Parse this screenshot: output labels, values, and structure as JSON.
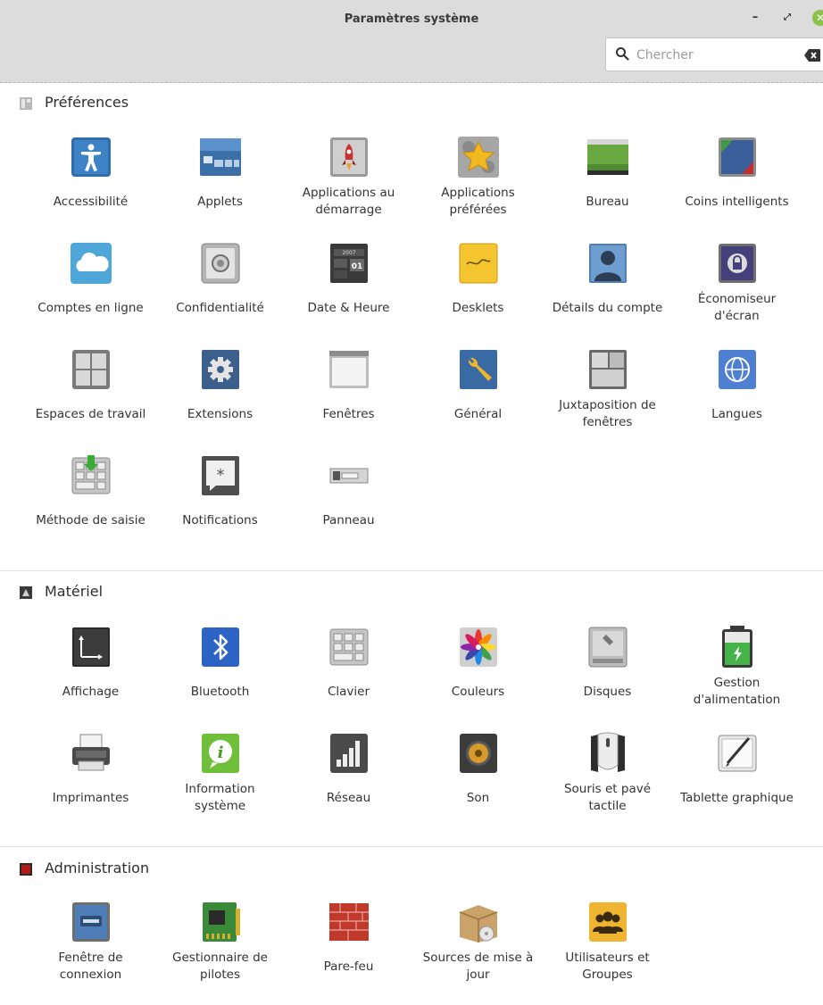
{
  "window": {
    "title": "Paramètres système",
    "min_glyph": "–",
    "max_glyph": "⤢",
    "close_glyph": "✕"
  },
  "search": {
    "placeholder": "Chercher",
    "value": ""
  },
  "sections": {
    "preferences": {
      "title": "Préférences",
      "items": [
        {
          "label": "Accessibilité",
          "icon": "accessibility-icon"
        },
        {
          "label": "Applets",
          "icon": "applets-icon"
        },
        {
          "label": "Applications au démarrage",
          "icon": "startup-applications-icon"
        },
        {
          "label": "Applications préférées",
          "icon": "preferred-applications-icon"
        },
        {
          "label": "Bureau",
          "icon": "desktop-icon"
        },
        {
          "label": "Coins intelligents",
          "icon": "hot-corners-icon"
        },
        {
          "label": "Comptes en ligne",
          "icon": "online-accounts-icon"
        },
        {
          "label": "Confidentialité",
          "icon": "privacy-icon"
        },
        {
          "label": "Date & Heure",
          "icon": "calendar-clock-icon"
        },
        {
          "label": "Desklets",
          "icon": "desklets-icon"
        },
        {
          "label": "Détails du compte",
          "icon": "account-details-icon"
        },
        {
          "label": "Économiseur d'écran",
          "icon": "screensaver-lock-icon"
        },
        {
          "label": "Espaces de travail",
          "icon": "workspaces-icon"
        },
        {
          "label": "Extensions",
          "icon": "extensions-gear-icon"
        },
        {
          "label": "Fenêtres",
          "icon": "windows-icon"
        },
        {
          "label": "Général",
          "icon": "general-wrench-icon"
        },
        {
          "label": "Juxtaposition de fenêtres",
          "icon": "window-tiling-icon"
        },
        {
          "label": "Langues",
          "icon": "languages-globe-icon"
        },
        {
          "label": "Méthode de saisie",
          "icon": "input-method-icon"
        },
        {
          "label": "Notifications",
          "icon": "notifications-icon"
        },
        {
          "label": "Panneau",
          "icon": "panel-icon"
        }
      ]
    },
    "hardware": {
      "title": "Matériel",
      "items": [
        {
          "label": "Affichage",
          "icon": "display-icon"
        },
        {
          "label": "Bluetooth",
          "icon": "bluetooth-icon"
        },
        {
          "label": "Clavier",
          "icon": "keyboard-icon"
        },
        {
          "label": "Couleurs",
          "icon": "colors-icon"
        },
        {
          "label": "Disques",
          "icon": "disks-icon"
        },
        {
          "label": "Gestion d'alimentation",
          "icon": "battery-icon"
        },
        {
          "label": "Imprimantes",
          "icon": "printer-icon"
        },
        {
          "label": "Information système",
          "icon": "system-info-icon"
        },
        {
          "label": "Réseau",
          "icon": "network-signal-icon"
        },
        {
          "label": "Son",
          "icon": "speaker-icon"
        },
        {
          "label": "Souris et pavé tactile",
          "icon": "mouse-icon"
        },
        {
          "label": "Tablette graphique",
          "icon": "graphics-tablet-icon"
        }
      ]
    },
    "administration": {
      "title": "Administration",
      "items": [
        {
          "label": "Fenêtre de connexion",
          "icon": "login-window-icon"
        },
        {
          "label": "Gestionnaire de pilotes",
          "icon": "driver-manager-icon"
        },
        {
          "label": "Pare-feu",
          "icon": "firewall-icon"
        },
        {
          "label": "Sources de mise à jour",
          "icon": "software-sources-icon"
        },
        {
          "label": "Utilisateurs et Groupes",
          "icon": "users-groups-icon"
        }
      ]
    }
  }
}
